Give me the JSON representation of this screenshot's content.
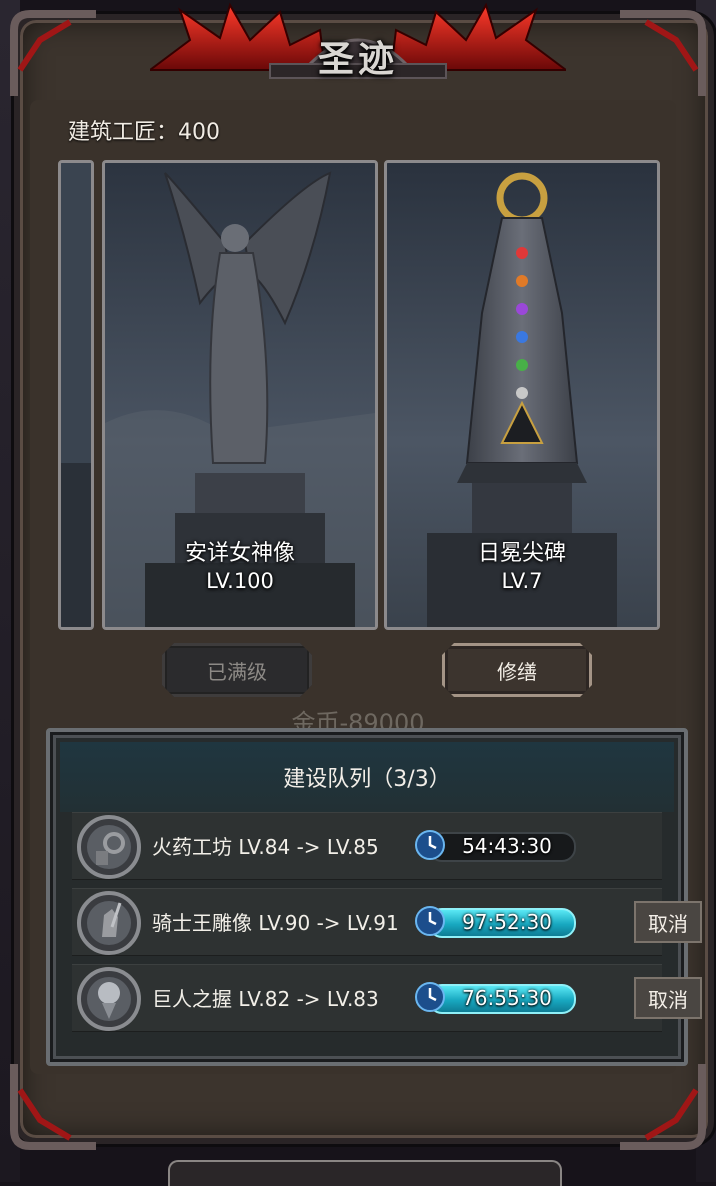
{
  "header": {
    "title": "圣迹"
  },
  "builders": {
    "label": "建筑工匠：400"
  },
  "cards": [
    {
      "name": "安详女神像",
      "level": "LV.100"
    },
    {
      "name": "日冕尖碑",
      "level": "LV.7"
    }
  ],
  "actions": {
    "maxed_label": "已满级",
    "repair_label": "修缮",
    "cost_label": "金币-89000"
  },
  "queue": {
    "title": "建设队列（3/3）",
    "items": [
      {
        "name": "火药工坊 LV.84 -> LV.85",
        "time": "54:43:30",
        "progress": 0.0,
        "icon": "gear-building-icon",
        "cancel": null
      },
      {
        "name": "骑士王雕像 LV.90 -> LV.91",
        "time": "97:52:30",
        "progress": 1.0,
        "icon": "knight-statue-icon",
        "cancel": "取消"
      },
      {
        "name": "巨人之握 LV.82 -> LV.83",
        "time": "76:55:30",
        "progress": 1.0,
        "icon": "giant-grip-icon",
        "cancel": "取消"
      }
    ]
  },
  "colors": {
    "timer_fill": "#18a8c0",
    "panel": "#3c342d",
    "crest_red": "#b01818"
  }
}
